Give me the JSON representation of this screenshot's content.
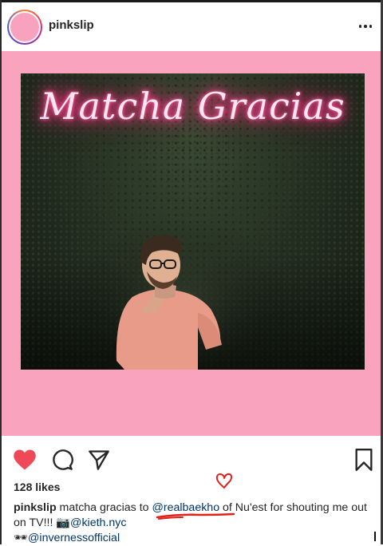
{
  "post": {
    "username": "pinkslip",
    "image_text": "Matcha Gracias",
    "likes": "128 likes",
    "caption": {
      "username": "pinkslip",
      "text_1": " matcha gracias to ",
      "mention_1": "@realbaekho",
      "text_2": " of Nu'est for shouting me out on TV!!! ",
      "camera_emoji": "📷",
      "mention_2": "@kieth.nyc",
      "sunglasses_emoji": "🕶",
      "mention_3": "@invernessofficial"
    }
  },
  "icons": {
    "like": "heart-filled-icon",
    "comment": "comment-icon",
    "share": "send-icon",
    "save": "bookmark-icon",
    "more": "more-options-icon"
  },
  "colors": {
    "post_background": "#f9a3bf",
    "like_red": "#ed4956",
    "mention_blue": "#003569",
    "annotation_red": "#e0201a",
    "neon_pink": "#ff2d7e"
  }
}
